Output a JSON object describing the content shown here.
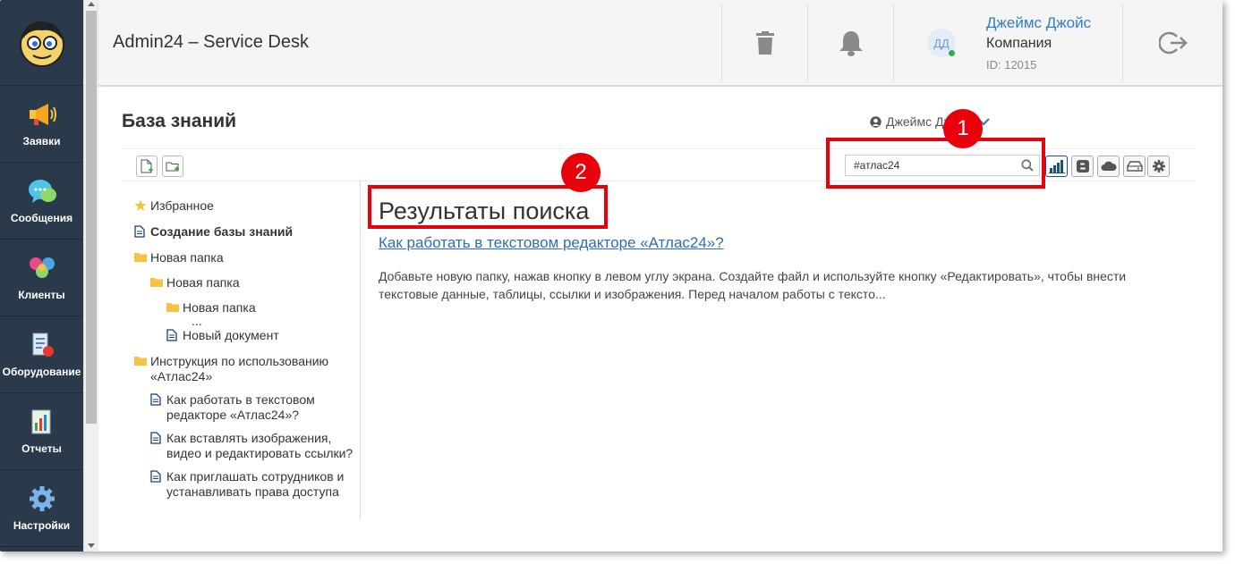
{
  "header": {
    "title": "Admin24 – Service Desk",
    "user": {
      "initials": "ДД",
      "name": "Джеймс Джойс",
      "company": "Компания",
      "id": "ID: 12015"
    }
  },
  "sidebar": {
    "items": [
      {
        "label": "Заявки",
        "icon": "megaphone-icon"
      },
      {
        "label": "Сообщения",
        "icon": "chat-icon"
      },
      {
        "label": "Клиенты",
        "icon": "clients-icon"
      },
      {
        "label": "Оборудование",
        "icon": "equipment-icon"
      },
      {
        "label": "Отчеты",
        "icon": "reports-icon"
      },
      {
        "label": "Настройки",
        "icon": "gear-icon"
      }
    ]
  },
  "page": {
    "title": "База знаний",
    "owner": "Джеймс Джойс",
    "search_value": "#атлас24"
  },
  "tree": {
    "items": [
      {
        "label": "Избранное",
        "icon": "star"
      },
      {
        "label": "Создание базы знаний",
        "icon": "doc",
        "bold": true
      },
      {
        "label": "Новая папка",
        "icon": "folder"
      },
      {
        "label": "Новая папка",
        "icon": "folder"
      },
      {
        "label": "Новая папка",
        "icon": "folder"
      },
      {
        "label": "...",
        "icon": ""
      },
      {
        "label": "Новый документ",
        "icon": "doc"
      },
      {
        "label": "Инструкция по использованию «Атлас24»",
        "icon": "folder"
      },
      {
        "label": "Как работать в текстовом редакторе «Атлас24»?",
        "icon": "doc"
      },
      {
        "label": "Как вставлять изображения, видео и редактировать ссылки?",
        "icon": "doc"
      },
      {
        "label": "Как приглашать сотрудников и устанавливать права доступа",
        "icon": "doc"
      }
    ]
  },
  "results": {
    "title": "Результаты поиска",
    "link": "Как работать в текстовом редакторе «Атлас24»?",
    "snippet": "Добавьте новую папку, нажав кнопку в левом углу экрана. Создайте файл и используйте кнопку «Редактировать», чтобы внести текстовые данные, таблицы, ссылки и изображения. Перед началом работы с тексто..."
  },
  "annotations": {
    "badge1": "1",
    "badge2": "2"
  },
  "colors": {
    "sidebar": "#2b3a4a",
    "link": "#2f6db5",
    "annotation": "#e8000b",
    "user_name": "#2f7ec5"
  }
}
